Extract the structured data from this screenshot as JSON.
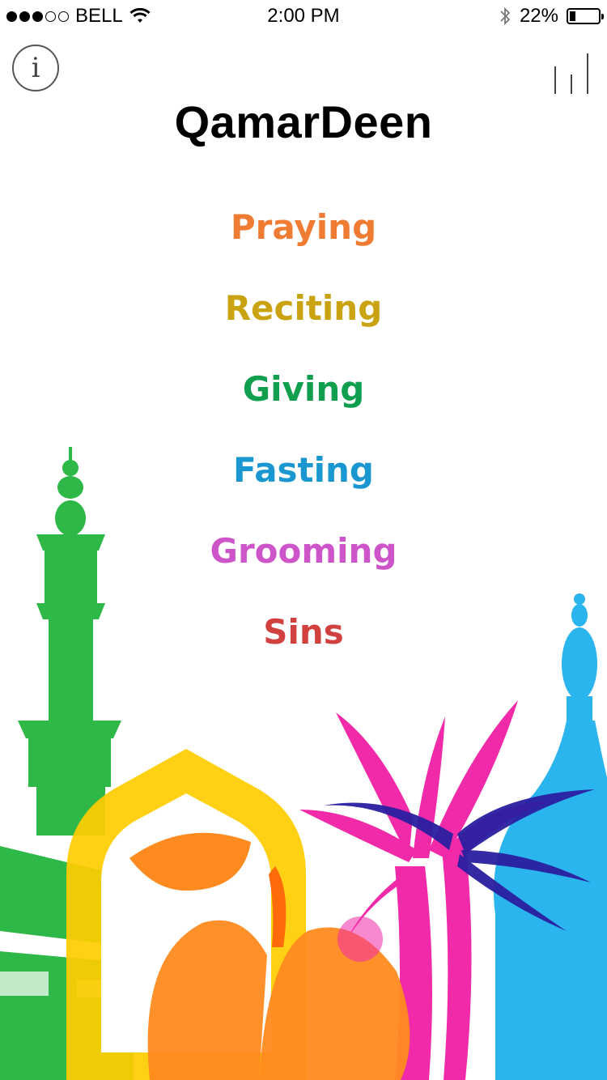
{
  "status_bar": {
    "carrier": "BELL",
    "time": "2:00 PM",
    "battery_percent": "22%",
    "battery_level": 0.22,
    "signal_bars_filled": 3,
    "signal_bars_total": 5,
    "icons": [
      "wifi-icon",
      "bluetooth-icon",
      "battery-icon"
    ]
  },
  "header": {
    "title": "QamarDeen",
    "info_icon": "info-icon",
    "info_glyph": "i",
    "stats_icon": "stats-icon"
  },
  "menu": {
    "items": [
      {
        "label": "Praying",
        "color": "#F07C33"
      },
      {
        "label": "Reciting",
        "color": "#C9A311"
      },
      {
        "label": "Giving",
        "color": "#0F9F4F"
      },
      {
        "label": "Fasting",
        "color": "#1A97D1"
      },
      {
        "label": "Grooming",
        "color": "#CE55C9"
      },
      {
        "label": "Sins",
        "color": "#D0413F"
      }
    ]
  },
  "illustration": {
    "elements": [
      "minaret",
      "kaaba",
      "arch",
      "date-fruit",
      "palm-trees",
      "dome"
    ],
    "colors": {
      "minaret": "#2DB847",
      "arch": "#FFCC00",
      "fruit": "#FF8A1F",
      "palm": "#F02AA8",
      "palm_dark": "#2A1FA0",
      "dome": "#2BB5EE"
    }
  }
}
